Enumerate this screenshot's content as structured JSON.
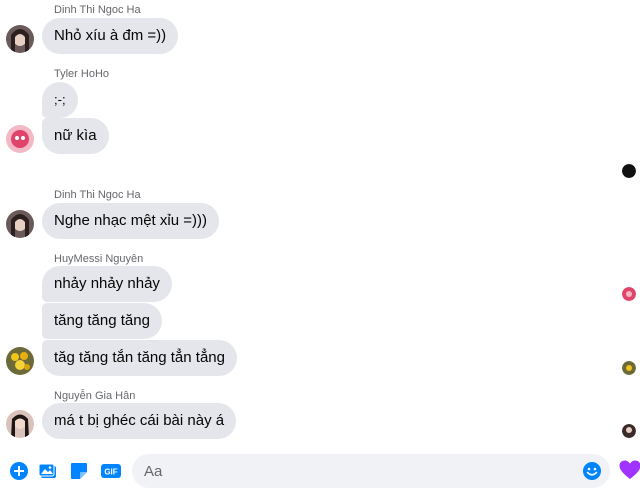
{
  "messages": [
    {
      "sender": "Dinh Thi Ngoc Ha",
      "bubbles": [
        "Nhỏ xíu à đm =))"
      ]
    },
    {
      "sender": "Tyler HoHo",
      "bubbles": [
        ";-;",
        "nữ kìa"
      ]
    },
    {
      "sender": "Dinh Thi Ngoc Ha",
      "bubbles": [
        "Nghe nhạc mệt xỉu =)))"
      ]
    },
    {
      "sender": "HuyMessi Nguyên",
      "bubbles": [
        "nhảy nhảy nhảy",
        "tăng tăng tăng",
        "tăg tăng tắn tăng tẳn tẳng"
      ]
    },
    {
      "sender": "Nguyễn Gia Hân",
      "bubbles": [
        "má t bị ghéc cái bài này á"
      ]
    }
  ],
  "composer": {
    "placeholder": "Aa",
    "icons": [
      "plus-icon",
      "image-icon",
      "sticker-icon",
      "gif-icon",
      "emoji-icon",
      "heart-icon"
    ],
    "gif_label": "GIF"
  },
  "colors": {
    "bubble": "#e4e6eb",
    "accent": "#0084ff",
    "heart": "#a033ff",
    "sender_text": "#65676b"
  }
}
